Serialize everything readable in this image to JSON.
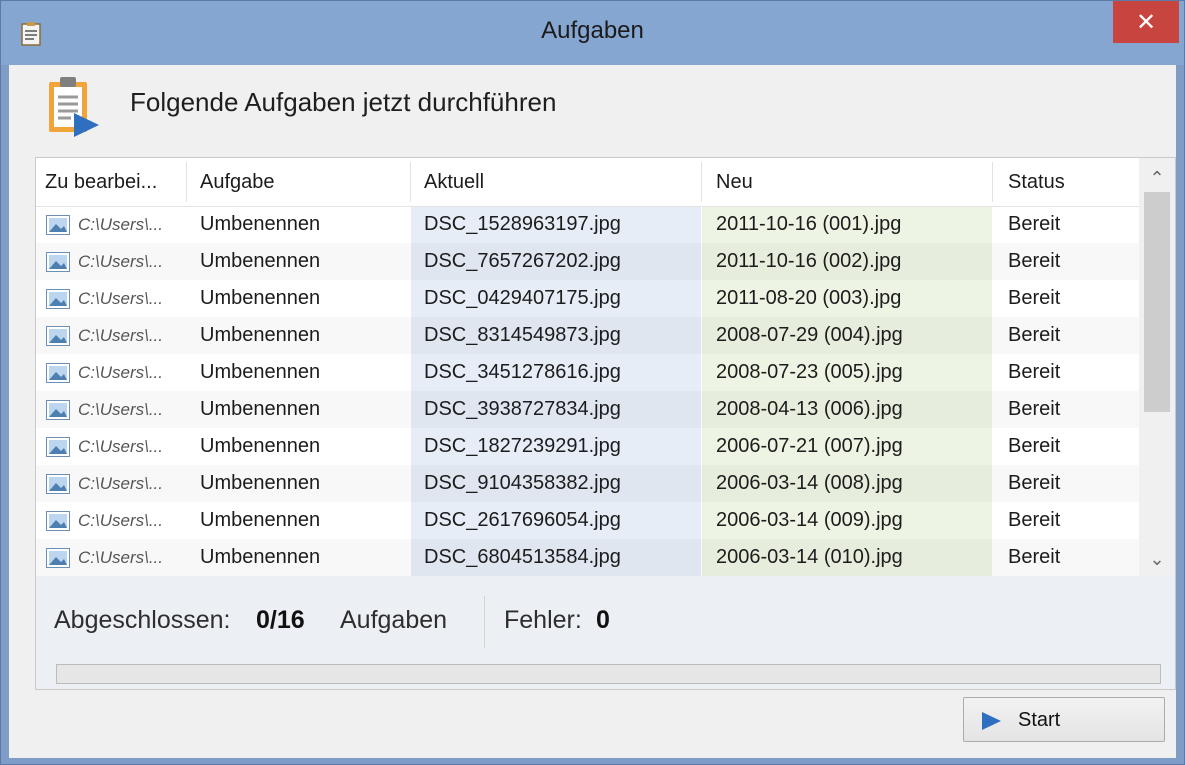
{
  "window": {
    "title": "Aufgaben",
    "close_glyph": "✕"
  },
  "heading": "Folgende Aufgaben jetzt durchführen",
  "table": {
    "columns": [
      "Zu bearbei...",
      "Aufgabe",
      "Aktuell",
      "Neu",
      "Status"
    ],
    "rows": [
      {
        "path": "C:\\Users\\...",
        "task": "Umbenennen",
        "current": "DSC_1528963197.jpg",
        "new": "2011-10-16 (001).jpg",
        "status": "Bereit"
      },
      {
        "path": "C:\\Users\\...",
        "task": "Umbenennen",
        "current": "DSC_7657267202.jpg",
        "new": "2011-10-16 (002).jpg",
        "status": "Bereit"
      },
      {
        "path": "C:\\Users\\...",
        "task": "Umbenennen",
        "current": "DSC_0429407175.jpg",
        "new": "2011-08-20 (003).jpg",
        "status": "Bereit"
      },
      {
        "path": "C:\\Users\\...",
        "task": "Umbenennen",
        "current": "DSC_8314549873.jpg",
        "new": "2008-07-29 (004).jpg",
        "status": "Bereit"
      },
      {
        "path": "C:\\Users\\...",
        "task": "Umbenennen",
        "current": "DSC_3451278616.jpg",
        "new": "2008-07-23 (005).jpg",
        "status": "Bereit"
      },
      {
        "path": "C:\\Users\\...",
        "task": "Umbenennen",
        "current": "DSC_3938727834.jpg",
        "new": "2008-04-13 (006).jpg",
        "status": "Bereit"
      },
      {
        "path": "C:\\Users\\...",
        "task": "Umbenennen",
        "current": "DSC_1827239291.jpg",
        "new": "2006-07-21 (007).jpg",
        "status": "Bereit"
      },
      {
        "path": "C:\\Users\\...",
        "task": "Umbenennen",
        "current": "DSC_9104358382.jpg",
        "new": "2006-03-14 (008).jpg",
        "status": "Bereit"
      },
      {
        "path": "C:\\Users\\...",
        "task": "Umbenennen",
        "current": "DSC_2617696054.jpg",
        "new": "2006-03-14 (009).jpg",
        "status": "Bereit"
      },
      {
        "path": "C:\\Users\\...",
        "task": "Umbenennen",
        "current": "DSC_6804513584.jpg",
        "new": "2006-03-14 (010).jpg",
        "status": "Bereit"
      }
    ]
  },
  "summary": {
    "completed_label": "Abgeschlossen:",
    "completed_value": "0/16",
    "tasks_label": "Aufgaben",
    "errors_label": "Fehler:",
    "errors_value": "0",
    "progress_fraction": 0
  },
  "buttons": {
    "start_label": "Start"
  },
  "icons": {
    "app": "tasks-app-icon",
    "header": "clipboard-play-icon",
    "row": "image-file-icon",
    "start": "play-icon"
  },
  "colors": {
    "titlebar": "#86a6d2",
    "close": "#c8443f",
    "accent": "#2f6fc0",
    "clipboard": "#f0a43a"
  }
}
